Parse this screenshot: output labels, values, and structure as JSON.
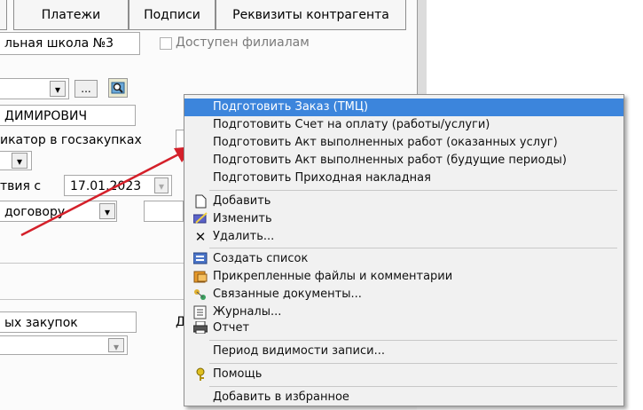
{
  "tabs": [
    "Платежи",
    "Подписи",
    "Реквизиты контрагента"
  ],
  "form": {
    "school_value": "льная школа №3",
    "branch_checkbox_label": "Доступен филиалам",
    "browse_button": "...",
    "person_value": "ДИМИРОВИЧ",
    "identifier_label": "икатор в госзакупках",
    "validity_label": "твия с",
    "validity_date": "17.01.2023",
    "contract_value": "договору",
    "purchase_value": "ых закупок",
    "trailing_letter": "Д"
  },
  "context_menu": {
    "items": [
      {
        "label": "Подготовить Заказ (ТМЦ)",
        "icon": "",
        "highlighted": true
      },
      {
        "label": "Подготовить Счет на оплату (работы/услуги)",
        "icon": ""
      },
      {
        "label": "Подготовить Акт выполненных работ (оказанных услуг)",
        "icon": ""
      },
      {
        "label": "Подготовить Акт выполненных работ (будущие периоды)",
        "icon": ""
      },
      {
        "label": "Подготовить Приходная накладная",
        "icon": ""
      },
      {
        "label": "Добавить",
        "icon": "new-document-icon"
      },
      {
        "label": "Изменить",
        "icon": "edit-icon"
      },
      {
        "label": "Удалить...",
        "icon": "delete-cross-icon"
      },
      {
        "label": "Создать список",
        "icon": "create-list-icon"
      },
      {
        "label": "Прикрепленные файлы и комментарии",
        "icon": "attachments-icon"
      },
      {
        "label": "Связанные документы...",
        "icon": "related-documents-icon"
      },
      {
        "label": "Журналы...",
        "icon": "journals-icon"
      },
      {
        "label": "Отчет",
        "icon": "printer-icon"
      },
      {
        "label": "Период видимости записи...",
        "icon": ""
      },
      {
        "label": "Помощь",
        "icon": "help-key-icon"
      },
      {
        "label": "Добавить в избранное",
        "icon": ""
      }
    ]
  },
  "colors": {
    "highlight": "#3c85dc",
    "arrow": "#d4202a",
    "menu_bg": "#f1f1f1"
  }
}
